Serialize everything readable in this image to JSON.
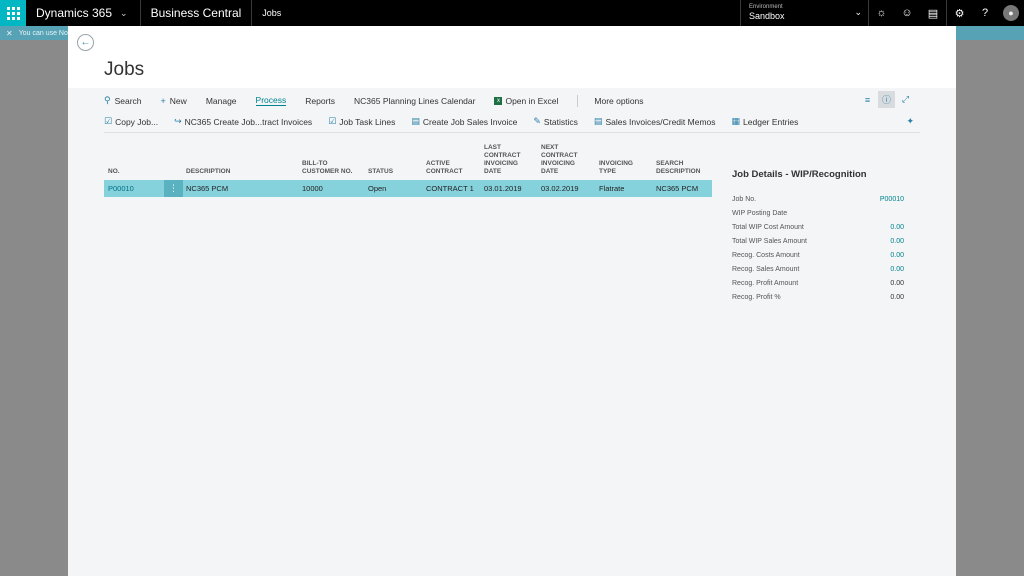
{
  "topbar": {
    "brand": "Dynamics 365",
    "app": "Business Central",
    "breadcrumb": "Jobs",
    "env_label": "Environment",
    "env_value": "Sandbox",
    "icons": [
      "lightbulb-icon",
      "smiley-icon",
      "chat-icon",
      "gear-icon",
      "help-icon",
      "user-icon"
    ]
  },
  "notification": {
    "text": "You can use No"
  },
  "page": {
    "title": "Jobs",
    "actions": [
      {
        "label": "Search",
        "icon": "search-icon"
      },
      {
        "label": "New",
        "icon": "plus-icon"
      },
      {
        "label": "Manage"
      },
      {
        "label": "Process",
        "active": true
      },
      {
        "label": "Reports"
      },
      {
        "label": "NC365 Planning Lines Calendar"
      },
      {
        "label": "Open in Excel",
        "icon": "excel-icon"
      },
      {
        "label": "More options"
      }
    ],
    "sub_actions": [
      {
        "label": "Copy Job...",
        "icon": "copy-icon"
      },
      {
        "label": "NC365 Create Job...tract Invoices",
        "icon": "arrow-icon"
      },
      {
        "label": "Job Task Lines",
        "icon": "list-icon"
      },
      {
        "label": "Create Job Sales Invoice",
        "icon": "document-icon"
      },
      {
        "label": "Statistics",
        "icon": "chart-icon"
      },
      {
        "label": "Sales Invoices/Credit Memos",
        "icon": "invoice-icon"
      },
      {
        "label": "Ledger Entries",
        "icon": "ledger-icon"
      }
    ]
  },
  "grid": {
    "columns": [
      "No.",
      "Description",
      "Bill-to Customer No.",
      "Status",
      "Active Contract",
      "Last Contract Invoicing Date",
      "Next Contract Invoicing Date",
      "Invoicing Type",
      "Search Description"
    ],
    "header_lines": {
      "no": [
        "No."
      ],
      "description": [
        "Description"
      ],
      "bill_to": [
        "Bill-to",
        "Customer No."
      ],
      "status": [
        "Status"
      ],
      "active_contract": [
        "Active",
        "Contract"
      ],
      "last_inv": [
        "Last",
        "Contract",
        "Invoicing",
        "Date"
      ],
      "next_inv": [
        "Next",
        "Contract",
        "Invoicing",
        "Date"
      ],
      "inv_type": [
        "Invoicing",
        "Type"
      ],
      "search_desc": [
        "Search",
        "Description"
      ]
    },
    "rows": [
      {
        "no": "P00010",
        "description": "NC365 PCM",
        "bill_to": "10000",
        "status": "Open",
        "active_contract": "CONTRACT 1",
        "last_inv": "03.01.2019",
        "next_inv": "03.02.2019",
        "inv_type": "Flatrate",
        "search_desc": "NC365 PCM"
      }
    ]
  },
  "factbox": {
    "title": "Job Details - WIP/Recognition",
    "rows": [
      {
        "label": "Job No.",
        "value": "P00010",
        "link": true
      },
      {
        "label": "WIP Posting Date",
        "value": ""
      },
      {
        "label": "Total WIP Cost Amount",
        "value": "0.00",
        "link": true
      },
      {
        "label": "Total WIP Sales Amount",
        "value": "0.00",
        "link": true
      },
      {
        "label": "Recog. Costs Amount",
        "value": "0.00",
        "link": true
      },
      {
        "label": "Recog. Sales Amount",
        "value": "0.00",
        "link": true
      },
      {
        "label": "Recog. Profit Amount",
        "value": "0.00"
      },
      {
        "label": "Recog. Profit %",
        "value": "0.00"
      }
    ]
  }
}
